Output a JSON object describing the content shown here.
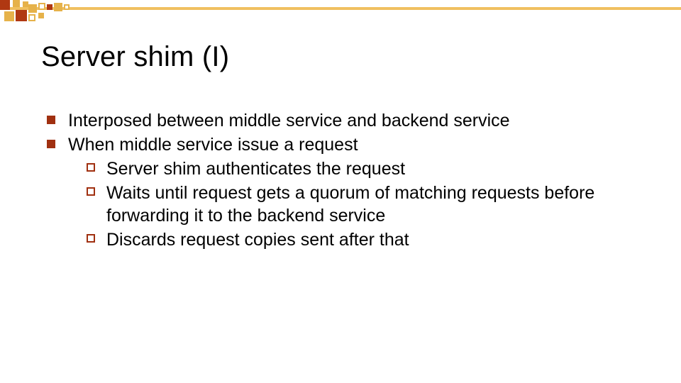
{
  "title": "Server shim (I)",
  "bullets": [
    {
      "text": "Interposed between middle service and backend service"
    },
    {
      "text": "When middle service issue a request",
      "children": [
        " Server shim authenticates the request",
        "Waits until request gets a quorum of matching requests before forwarding it  to the backend service",
        "Discards request copies sent after that"
      ]
    }
  ],
  "theme": {
    "accent_dark": "#a03010",
    "accent_light": "#e6b24a",
    "bullet_filled": "filled-square",
    "bullet_hollow": "hollow-square"
  }
}
